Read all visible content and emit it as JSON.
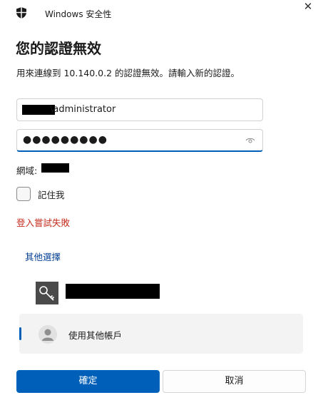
{
  "window": {
    "app_title": "Windows 安全性",
    "close_glyph": "✕"
  },
  "dialog": {
    "heading": "您的認證無效",
    "description": "用來連線到 10.140.0.2 的認證無效。請輸入新的認證。"
  },
  "username_field": {
    "value": "\\administrator",
    "masked_prefix": true
  },
  "password_field": {
    "value": "●●●●●●●●●",
    "reveal_icon": "eye-icon"
  },
  "domain": {
    "label": "網域:",
    "value_masked": true
  },
  "remember_me": {
    "label": "記住我",
    "checked": false
  },
  "error_text": "登入嘗試失敗",
  "more_choices": "其他選擇",
  "accounts": {
    "primary": {
      "icon": "key-icon",
      "name_masked": true
    },
    "other": {
      "icon": "person-icon",
      "label": "使用其他帳戶",
      "selected": true
    }
  },
  "buttons": {
    "ok": "確定",
    "cancel": "取消"
  },
  "colors": {
    "accent": "#005fb8",
    "error": "#c42b1c",
    "link": "#003e92"
  }
}
